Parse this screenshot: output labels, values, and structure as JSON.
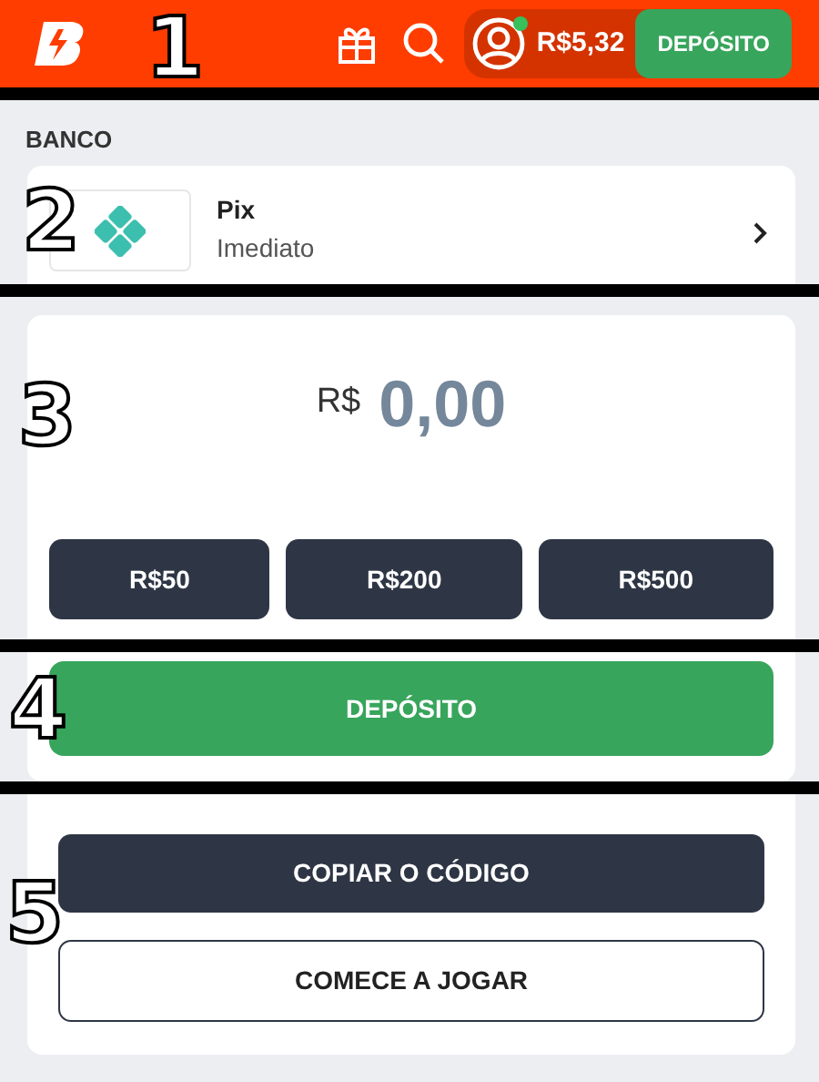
{
  "header": {
    "balance": "R$5,32",
    "deposit_button": "DEPÓSITO",
    "online": true
  },
  "section_label": "BANCO",
  "payment_method": {
    "name": "Pix",
    "subtitle": "Imediato"
  },
  "amount": {
    "currency": "R$",
    "value": "0,00"
  },
  "presets": [
    "R$50",
    "R$200",
    "R$500"
  ],
  "deposit_button": "DEPÓSITO",
  "actions": [
    {
      "label": "COPIAR O CÓDIGO",
      "kind": "primary"
    },
    {
      "label": "COMECE A JOGAR",
      "kind": "outline"
    }
  ],
  "annotations": [
    "1",
    "2",
    "3",
    "4",
    "5"
  ]
}
